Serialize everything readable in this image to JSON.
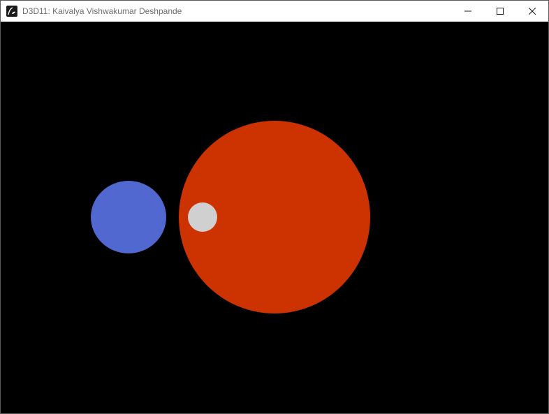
{
  "window": {
    "title": "D3D11: Kaivalya Vishwakumar Deshpande",
    "icon": "app-icon",
    "controls": {
      "minimize_icon": "minimize-icon",
      "maximize_icon": "maximize-icon",
      "close_icon": "close-icon"
    }
  },
  "scene": {
    "background_color": "#000000",
    "objects": [
      {
        "name": "large-red-circle",
        "color": "#cc3300"
      },
      {
        "name": "blue-ellipse",
        "color": "#5068d0"
      },
      {
        "name": "small-gray-circle",
        "color": "#d0d0d0"
      }
    ]
  }
}
